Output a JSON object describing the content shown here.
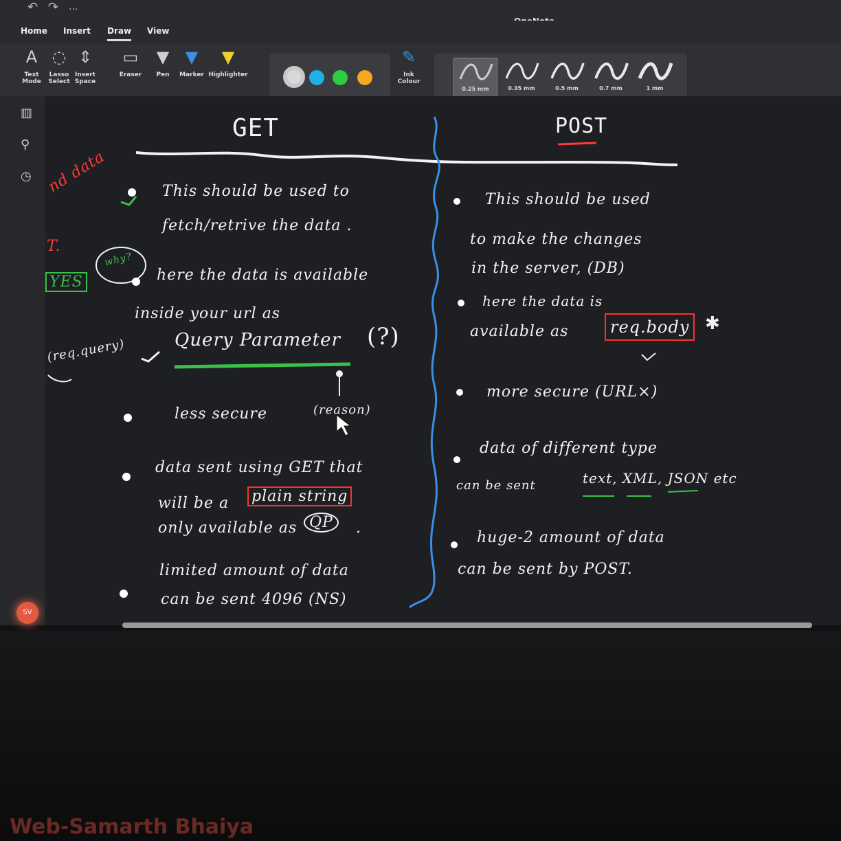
{
  "window": {
    "title": "OneNote",
    "quick_access": [
      "↶",
      "↷",
      "..."
    ]
  },
  "tabs": [
    {
      "label": "Home"
    },
    {
      "label": "Insert"
    },
    {
      "label": "Draw"
    },
    {
      "label": "View"
    }
  ],
  "active_tab": "Draw",
  "ribbon": {
    "text_mode": "Text Mode",
    "lasso_select": "Lasso Select",
    "insert_space": "Insert Space",
    "eraser": "Eraser",
    "pen": "Pen",
    "marker": "Marker",
    "highlighter": "Highlighter",
    "ink_colour": "Ink Colour",
    "pen_colors": [
      "#d8d8d8",
      "#1fb0e8",
      "#2ecc40",
      "#f5a623"
    ],
    "thickness": [
      "0.35 mm",
      "0.5 mm",
      "0.7 mm",
      "1 mm"
    ],
    "thickness_selected": "0.25 mm"
  },
  "sidebar": {
    "icons": [
      "notebooks-icon",
      "search-icon",
      "recent-icon"
    ],
    "avatar_initials": "SV"
  },
  "note": {
    "get_heading": "GET",
    "post_heading": "POST",
    "left_margin": {
      "snippet1": "nd data",
      "snippet2": "T.",
      "yes": "YES",
      "why": "why?",
      "req_query": "(req.query)"
    },
    "get_points": [
      {
        "line1": "This should be used to",
        "line2": "fetch/retrive the data ."
      },
      {
        "line1": "here the data is available",
        "line2": "inside your url as",
        "line3": "Query Parameter",
        "suffix": "(?)"
      },
      {
        "line1": "less secure",
        "suffix": "(reason)"
      },
      {
        "line1": "data sent using GET that",
        "line2_a": "will be a",
        "line2_box": "plain string",
        "line3_a": "only available as",
        "line3_circle": "QP",
        "line3_end": "."
      },
      {
        "line1": "limited amount of data",
        "line2": "can be sent 4096 (NS)"
      }
    ],
    "post_points": [
      {
        "line1": "This should be used",
        "line2": "to make the changes",
        "line3": "in the server, (DB)"
      },
      {
        "line1": "here the data is",
        "line2_a": "available as",
        "line2_box": "req.body",
        "star": "✱"
      },
      {
        "line1": "more secure (URL×)"
      },
      {
        "line1": "data of different type",
        "line2_a": "can be sent",
        "line2_b": "text, XML, JSON etc"
      },
      {
        "line1": "huge-2 amount of data",
        "line2": "can be sent by POST."
      }
    ]
  },
  "watermark": "Web-Samarth Bhaiya"
}
